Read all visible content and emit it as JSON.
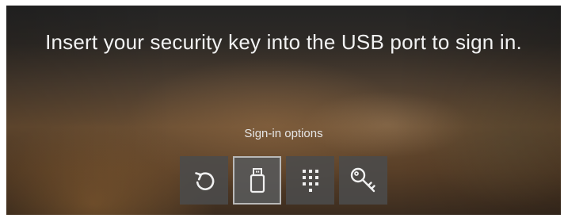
{
  "message": "Insert your security key into the USB port to sign in.",
  "signin_options": {
    "label": "Sign-in options",
    "options": [
      {
        "icon": "refresh-icon",
        "name": "Retry",
        "selected": false
      },
      {
        "icon": "usb-key-icon",
        "name": "Security key",
        "selected": true
      },
      {
        "icon": "pin-keypad-icon",
        "name": "PIN",
        "selected": false
      },
      {
        "icon": "key-icon",
        "name": "Password",
        "selected": false
      }
    ]
  }
}
